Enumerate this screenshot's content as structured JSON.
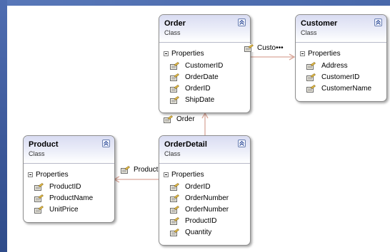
{
  "classes": {
    "order": {
      "name": "Order",
      "kind": "Class",
      "section": "Properties",
      "properties": [
        "CustomerID",
        "OrderDate",
        "OrderID",
        "ShipDate"
      ]
    },
    "customer": {
      "name": "Customer",
      "kind": "Class",
      "section": "Properties",
      "properties": [
        "Address",
        "CustomerID",
        "CustomerName"
      ]
    },
    "product": {
      "name": "Product",
      "kind": "Class",
      "section": "Properties",
      "properties": [
        "ProductID",
        "ProductName",
        "UnitPrice"
      ]
    },
    "orderdetail": {
      "name": "OrderDetail",
      "kind": "Class",
      "section": "Properties",
      "properties": [
        "OrderID",
        "OrderNumber",
        "OrderNumber",
        "ProductID",
        "Quantity"
      ]
    }
  },
  "associations": {
    "order_to_customer": "Custo•••",
    "orderdetail_to_order": "Order",
    "orderdetail_to_product": "Product"
  },
  "icons": {
    "collapse": "double-chevron-up-icon",
    "section_toggle": "minus-box-icon",
    "property": "property-icon"
  },
  "colors": {
    "header_gradient_top": "#d9dcf2",
    "border": "#8e8e8e",
    "connector": "#d9a89a",
    "background": "#3d5a9e"
  }
}
